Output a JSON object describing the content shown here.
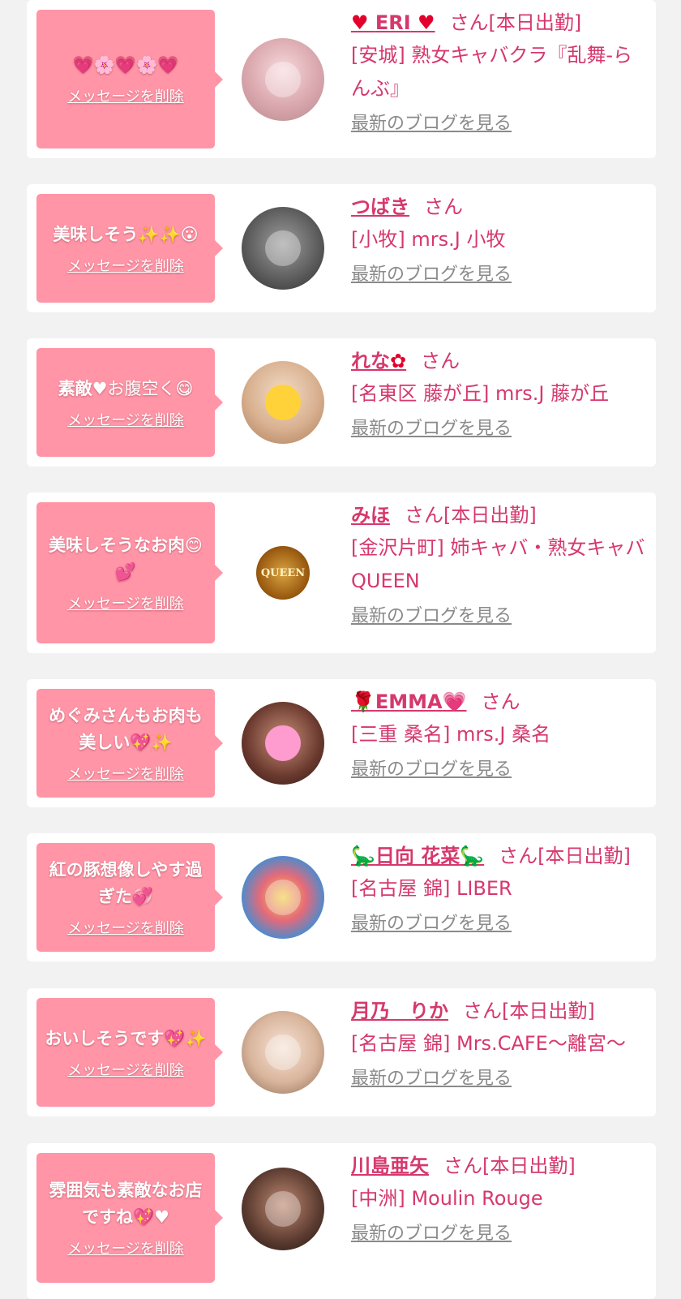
{
  "colors": {
    "bubble": "#ff95a6",
    "link": "#d6386c",
    "blog_link": "#8a8a8a",
    "page_bg": "#f2f2f2"
  },
  "labels": {
    "delete_message": "メッセージを削除",
    "latest_blog": "最新のブログを見る"
  },
  "messages": [
    {
      "message": "",
      "message_emoji": "💗🌸💗🌸💗",
      "name": "ERI",
      "name_prefix_emoji": "♥",
      "name_suffix_emoji": "♥",
      "honorific": "さん[本日出勤]",
      "shop": "[安城] 熟女キャバクラ『乱舞-らんぶ』"
    },
    {
      "message": "美味しそう",
      "message_emoji": "✨✨😮",
      "name": "つばき",
      "name_prefix_emoji": "",
      "name_suffix_emoji": "",
      "honorific": "さん",
      "shop": "[小牧] mrs.J 小牧"
    },
    {
      "message": "素敵",
      "message_emoji": "♥お腹空く😋",
      "name": "れな",
      "name_prefix_emoji": "",
      "name_suffix_emoji": "✿",
      "honorific": "さん",
      "shop": "[名東区 藤が丘] mrs.J 藤が丘"
    },
    {
      "message": "美味しそうなお肉",
      "message_emoji": "😊💕",
      "name": "みほ",
      "name_prefix_emoji": "",
      "name_suffix_emoji": "",
      "honorific": "さん[本日出勤]",
      "shop": "[金沢片町] 姉キャバ・熟女キャバ QUEEN",
      "avatar_text": "QUEEN"
    },
    {
      "message": "めぐみさんもお肉も美しい",
      "message_emoji": "💖✨",
      "name": "EMMA",
      "name_prefix_emoji": "🌹",
      "name_suffix_emoji": "💗",
      "honorific": "さん",
      "shop": "[三重 桑名] mrs.J 桑名"
    },
    {
      "message": "紅の豚想像しやす過ぎた",
      "message_emoji": "💞",
      "name": "日向 花菜",
      "name_prefix_emoji": "🦕",
      "name_suffix_emoji": "🦕",
      "honorific": "さん[本日出勤]",
      "shop": "[名古屋 錦] LIBER"
    },
    {
      "message": "おいしそうです",
      "message_emoji": "💖✨",
      "name": "月乃　りか",
      "name_prefix_emoji": "",
      "name_suffix_emoji": "",
      "honorific": "さん[本日出勤]",
      "shop": "[名古屋 錦] Mrs.CAFE〜離宮〜"
    },
    {
      "message": "雰囲気も素敵なお店ですね",
      "message_emoji": "💖♥",
      "name": "川島亜矢",
      "name_prefix_emoji": "",
      "name_suffix_emoji": "",
      "honorific": "さん[本日出勤]",
      "shop": "[中洲] Moulin Rouge"
    }
  ]
}
